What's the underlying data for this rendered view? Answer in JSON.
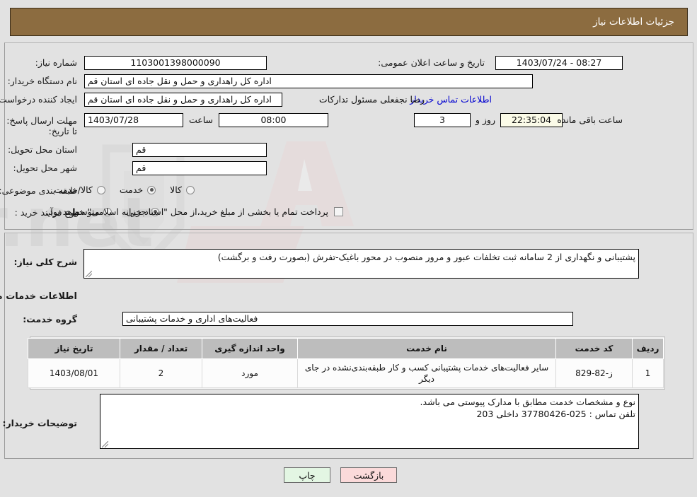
{
  "header": {
    "title": "جزئیات اطلاعات نیاز"
  },
  "form": {
    "need_number_label": "شماره نیاز:",
    "need_number_value": "1103001398000090",
    "announce_datetime_label": "تاریخ و ساعت اعلان عمومی:",
    "announce_datetime_value": "08:27 - 1403/07/24",
    "buyer_org_label": "نام دستگاه خریدار:",
    "buyer_org_value": "اداره کل راهداری و حمل و نقل جاده ای استان قم",
    "requester_label": "ایجاد کننده درخواست:",
    "requester_value": "اداره کل راهداری و حمل و نقل جاده ای استان قم",
    "requester_person": "رضا  نجفعلی مسئول تدارکات",
    "contact_link": "اطلاعات تماس خریدار",
    "deadline_label": "مهلت ارسال پاسخ: تا تاریخ:",
    "deadline_date": "1403/07/28",
    "deadline_hour_label": "ساعت",
    "deadline_hour": "08:00",
    "remaining_days": "3",
    "remaining_days_label": "روز و",
    "remaining_time": "22:35:04",
    "remaining_suffix": "ساعت باقی مانده",
    "province_label": "استان محل تحویل:",
    "province_value": "قم",
    "city_label": "شهر محل تحویل:",
    "city_value": "قم",
    "category_label": "طبقه بندی موضوعی:",
    "category_options": [
      {
        "label": "کالا",
        "selected": false
      },
      {
        "label": "خدمت",
        "selected": true
      },
      {
        "label": "کالا/خدمت",
        "selected": false
      }
    ],
    "process_label": "نوع فرآیند خرید :",
    "process_options": [
      {
        "label": "جزیی",
        "selected": true
      },
      {
        "label": "متوسط",
        "selected": false
      }
    ],
    "treasury_checkbox_label": "پرداخت تمام یا بخشی از مبلغ خرید،از محل \"اسناد خزانه اسلامی\" خواهد بود.",
    "treasury_checked": false
  },
  "description": {
    "label": "شرح کلی نیاز:",
    "value": "پشتیبانی و نگهداری از 2 سامانه ثبت تخلفات عبور و مرور منصوب در محور باغیک-تفرش (بصورت رفت و برگشت)"
  },
  "services_section": {
    "heading": "اطلاعات خدمات مورد نیاز",
    "group_label": "گروه خدمت:",
    "group_value": "فعالیت‌های اداری و خدمات پشتیبانی"
  },
  "table": {
    "columns": [
      "ردیف",
      "کد خدمت",
      "نام خدمت",
      "واحد اندازه گیری",
      "تعداد / مقدار",
      "تاریخ نیاز"
    ],
    "rows": [
      {
        "row": "1",
        "code": "ز-82-829",
        "name": "سایر فعالیت‌های خدمات پشتیبانی کسب و کار طبقه‌بندی‌نشده در جای دیگر",
        "unit": "مورد",
        "qty": "2",
        "date": "1403/08/01"
      }
    ]
  },
  "buyer_notes": {
    "label": "توضیحات خریدار:",
    "line1": "نوع و مشخصات خدمت مطابق با مدارک پیوستی می باشد.",
    "line2": "تلفن تماس : 025-37780426 داخلی 203"
  },
  "footer": {
    "print_label": "چاپ",
    "back_label": "بازگشت"
  },
  "colors": {
    "header_brown": "#8c6c40",
    "link_blue": "#0000d0",
    "page_bg": "#e2e2e2",
    "table_header_gray": "#bdbdbd",
    "print_green": "#e3f6e3",
    "back_pink": "#fbdada",
    "countdown_cream": "#fbfbe8"
  },
  "watermark": {
    "text": "AriaTender.net"
  }
}
